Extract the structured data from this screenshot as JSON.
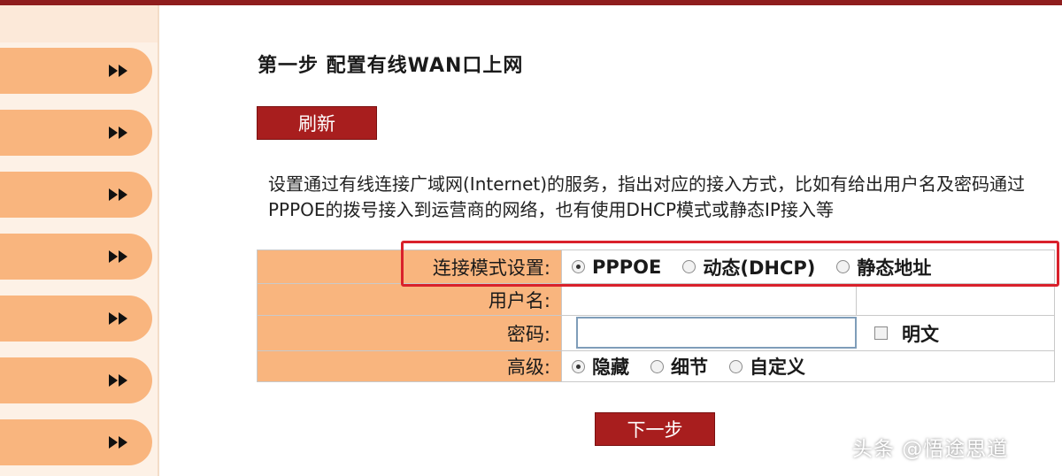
{
  "colors": {
    "accent_red": "#a81e1e",
    "sidebar_tab": "#f9b57e",
    "label_bg": "#f9b57e",
    "highlight_border": "#d9212b"
  },
  "sidebar": {
    "items": [
      {
        "icon": "double-chevron-right-icon"
      },
      {
        "icon": "double-chevron-right-icon"
      },
      {
        "icon": "double-chevron-right-icon"
      },
      {
        "icon": "double-chevron-right-icon"
      },
      {
        "icon": "double-chevron-right-icon"
      },
      {
        "icon": "double-chevron-right-icon"
      },
      {
        "icon": "double-chevron-right-icon"
      }
    ]
  },
  "main": {
    "title": "第一步 配置有线WAN口上网",
    "refresh_label": "刷新",
    "description": "设置通过有线连接广域网(Internet)的服务，指出对应的接入方式，比如有给出用户名及密码通过PPPOE的拨号接入到运营商的网络，也有使用DHCP模式或静态IP接入等",
    "next_label": "下一步"
  },
  "form": {
    "connection_mode": {
      "label": "连接模式设置:",
      "options": [
        "PPPOE",
        "动态(DHCP)",
        "静态地址"
      ],
      "selected": "PPPOE"
    },
    "username": {
      "label": "用户名:",
      "value": ""
    },
    "password": {
      "label": "密码:",
      "value": "",
      "show_plain_label": "明文",
      "show_plain_checked": false
    },
    "advanced": {
      "label": "高级:",
      "options": [
        "隐藏",
        "细节",
        "自定义"
      ],
      "selected": "隐藏"
    }
  },
  "watermark": "头条 @悟途思道"
}
